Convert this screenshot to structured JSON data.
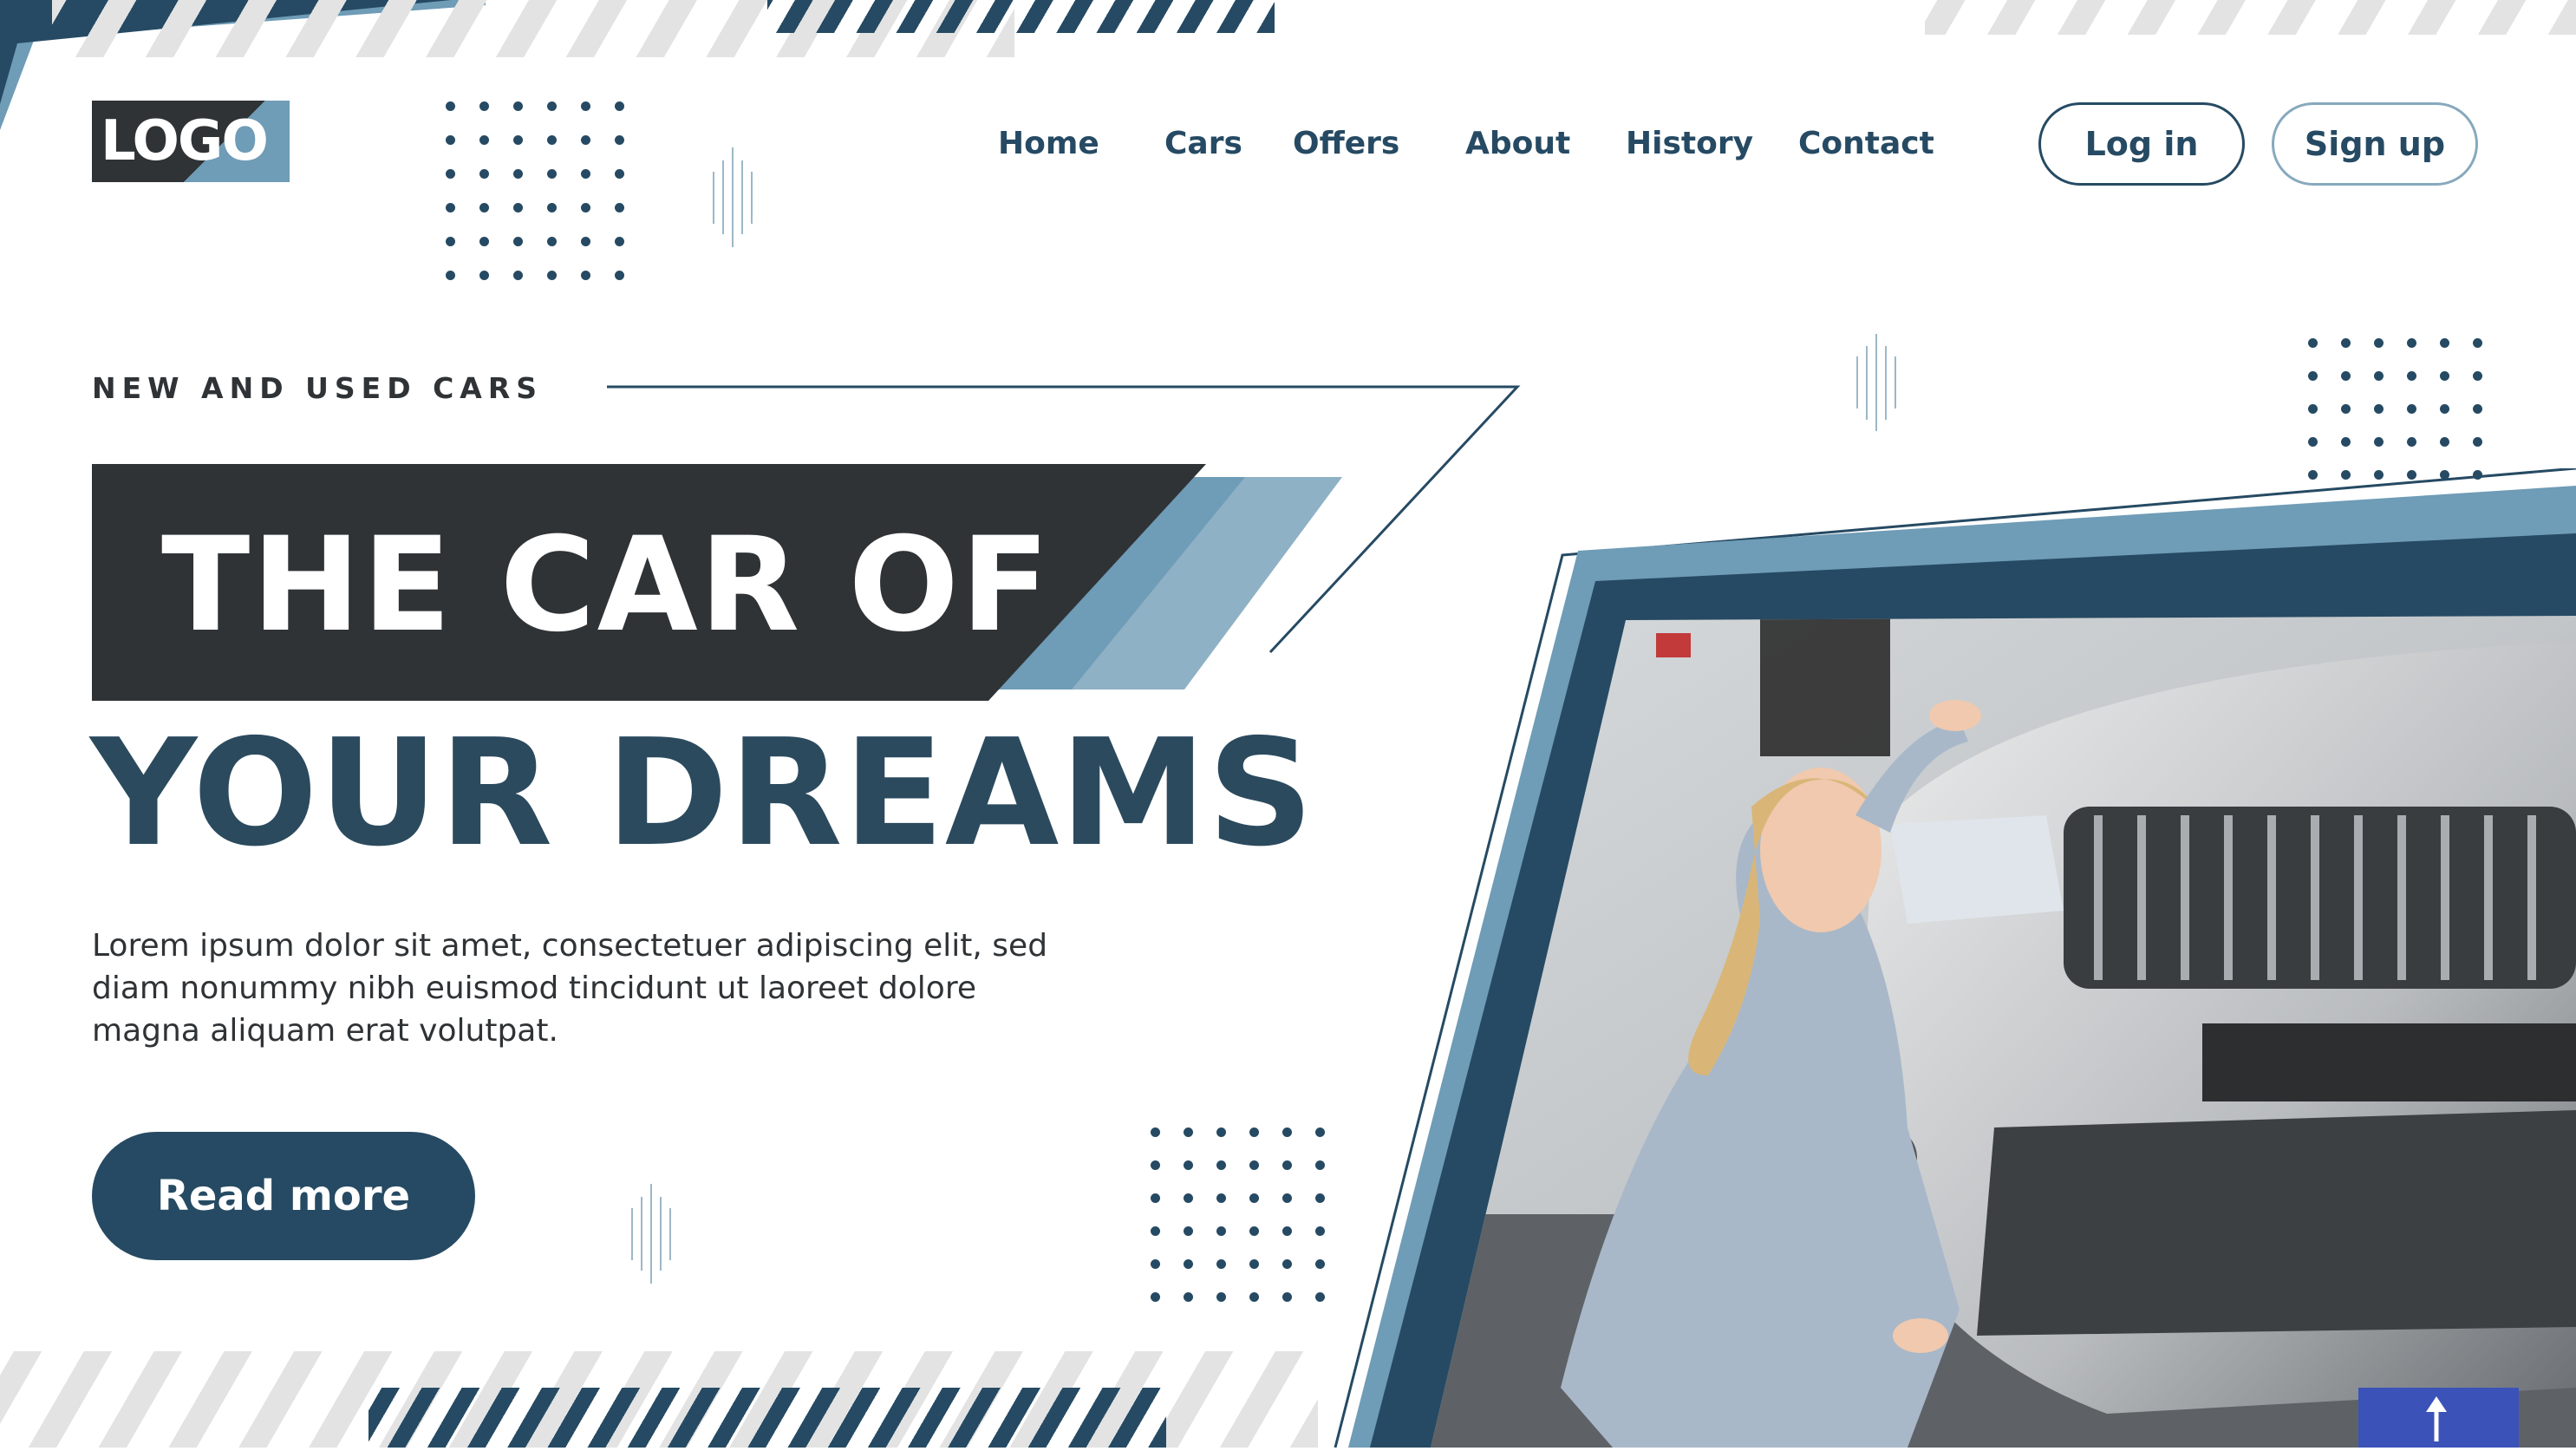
{
  "logo": {
    "text": "LOGO"
  },
  "nav": {
    "items": [
      {
        "label": "Home"
      },
      {
        "label": "Cars"
      },
      {
        "label": "Offers"
      },
      {
        "label": "About"
      },
      {
        "label": "History"
      },
      {
        "label": "Contact"
      }
    ],
    "login_label": "Log in",
    "signup_label": "Sign up"
  },
  "hero": {
    "eyebrow": "NEW AND USED CARS",
    "headline_line1": "THE CAR OF",
    "headline_line2": "YOUR DREAMS",
    "description": "Lorem ipsum dolor sit amet, consectetuer adipiscing elit, sed diam nonummy nibh euismod tincidunt ut laoreet dolore magna aliquam erat volutpat.",
    "cta_label": "Read more"
  },
  "colors": {
    "navy": "#264a63",
    "charcoal": "#2f3336",
    "steel_blue": "#6f9cb6",
    "light_blue": "#8fb1c5",
    "stripe_grey": "#e3e3e3"
  },
  "icons": {
    "decorative_dots": "dot-grid-icon",
    "decorative_lines": "barcode-lines-icon",
    "photo_marker": "up-arrow-icon"
  }
}
